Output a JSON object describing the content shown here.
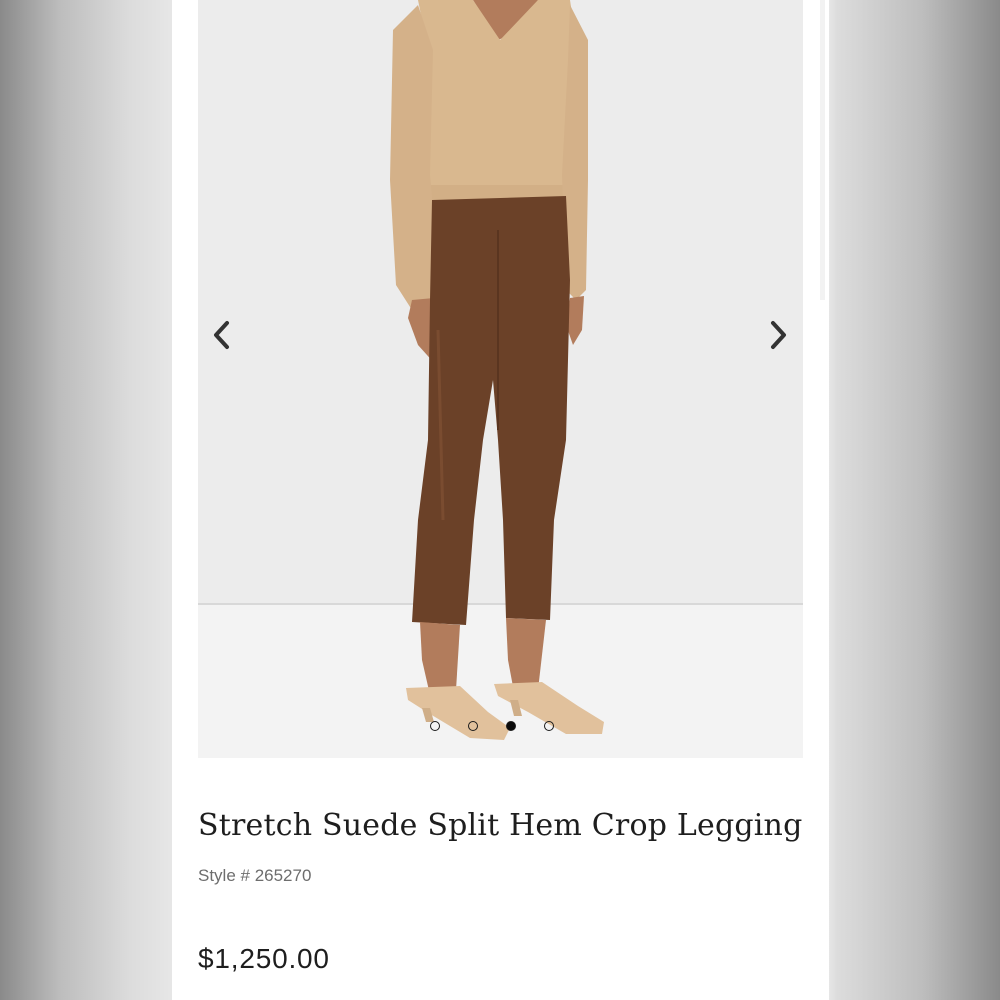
{
  "product": {
    "title": "Stretch Suede Split Hem Crop Legging",
    "style_label": "Style # 265270",
    "price": "$1,250.00"
  },
  "gallery": {
    "prev_icon": "chevron-left-icon",
    "next_icon": "chevron-right-icon",
    "image_count": 4,
    "active_index": 2
  },
  "colors": {
    "sweater": "#d9b88f",
    "legging": "#6b4128",
    "sandal": "#e1c19c",
    "skin": "#b27c5c",
    "backdrop": "#ececec",
    "floor": "#f3f3f3"
  }
}
